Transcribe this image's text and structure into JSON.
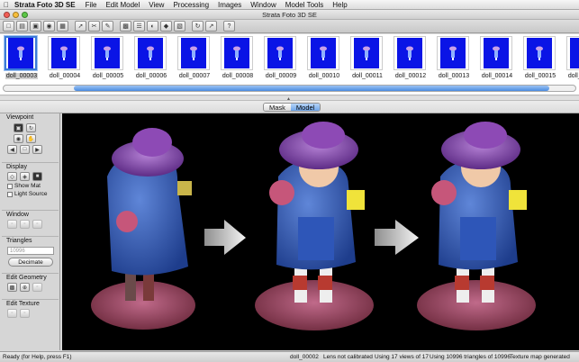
{
  "menubar": {
    "app": "Strata Foto 3D SE",
    "items": [
      "File",
      "Edit Model",
      "View",
      "Processing",
      "Images",
      "Window",
      "Model Tools",
      "Help"
    ]
  },
  "window": {
    "title": "Strata Foto 3D SE"
  },
  "thumbnails": [
    "doll_00003",
    "doll_00004",
    "doll_00005",
    "doll_00006",
    "doll_00007",
    "doll_00008",
    "doll_00009",
    "doll_00010",
    "doll_00011",
    "doll_00012",
    "doll_00013",
    "doll_00014",
    "doll_00015",
    "doll_00016",
    "doll_000"
  ],
  "modes": {
    "mask": "Mask",
    "model": "Model"
  },
  "sidebar": {
    "viewpoint": "Viewpoint",
    "display": "Display",
    "show_mat": "Show Mat",
    "light_source": "Light Source",
    "window": "Window",
    "triangles": "Triangles",
    "triangle_count": "10996",
    "decimate": "Decimate",
    "edit_geometry": "Edit Geometry",
    "edit_texture": "Edit Texture"
  },
  "status": {
    "help": "Ready (for Help, press F1)",
    "image": "doll_00002",
    "lens": "Lens not calibrated",
    "views": "Using 17 views of 17",
    "triangles": "Using 10996 triangles of 10996",
    "texture": "Texture map generated"
  },
  "colors": {
    "thumb_bg": "#0a14e6",
    "selection": "#3b7bd8",
    "viewport_bg": "#000000"
  }
}
